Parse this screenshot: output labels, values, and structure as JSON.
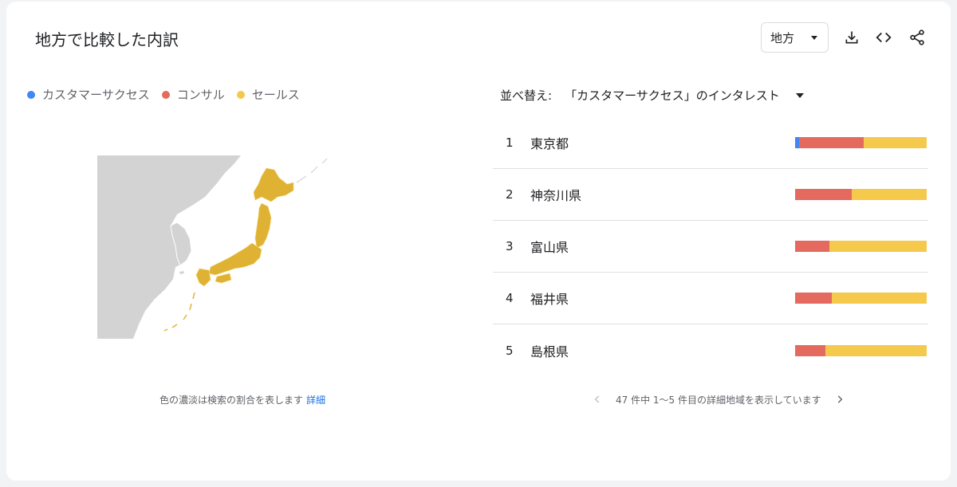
{
  "title": "地方で比較した内訳",
  "region_select": {
    "value": "地方"
  },
  "toolbar": {
    "download_icon": "download-icon",
    "embed_icon": "code-icon",
    "share_icon": "share-icon"
  },
  "legend": [
    {
      "label": "カスタマーサクセス",
      "color": "#4285f4"
    },
    {
      "label": "コンサル",
      "color": "#e46a5f"
    },
    {
      "label": "セールス",
      "color": "#f5c94c"
    }
  ],
  "map": {
    "highlight_color": "#e0b234",
    "land_color": "#d3d3d3"
  },
  "map_note": {
    "text": "色の濃淡は検索の割合を表します",
    "link": "詳細"
  },
  "sort": {
    "label": "並べ替え:",
    "value": "「カスタマーサクセス」のインタレスト"
  },
  "rows": [
    {
      "rank": "1",
      "name": "東京都",
      "shares": [
        3,
        49,
        48
      ]
    },
    {
      "rank": "2",
      "name": "神奈川県",
      "shares": [
        0,
        43,
        57
      ]
    },
    {
      "rank": "3",
      "name": "富山県",
      "shares": [
        0,
        26,
        74
      ]
    },
    {
      "rank": "4",
      "name": "福井県",
      "shares": [
        0,
        28,
        72
      ]
    },
    {
      "rank": "5",
      "name": "島根県",
      "shares": [
        0,
        23,
        77
      ]
    }
  ],
  "pager": {
    "text": "47 件中 1〜5 件目の詳細地域を表示しています"
  }
}
